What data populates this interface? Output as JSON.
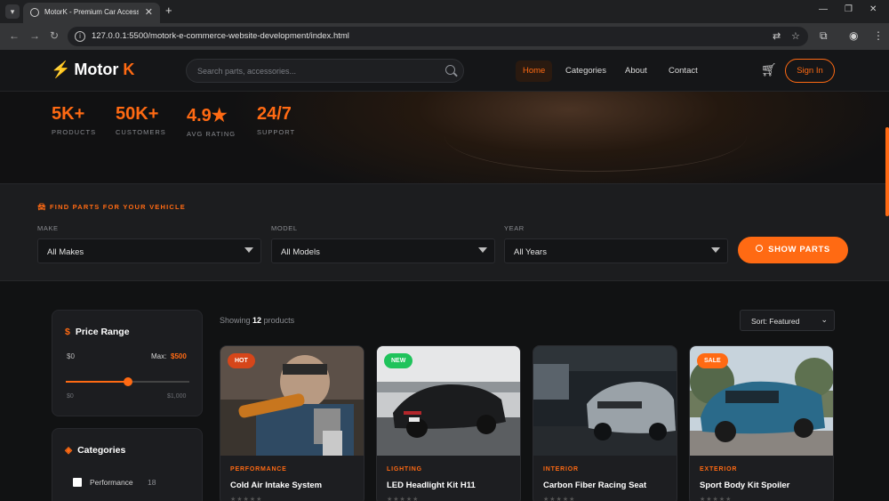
{
  "browser": {
    "tab_title": "MotorK - Premium Car Accessories",
    "url": "127.0.0.1:5500/motork-e-commerce-website-development/index.html"
  },
  "header": {
    "logo_main": "Motor ",
    "logo_accent": "K",
    "search_placeholder": "Search parts, accessories...",
    "nav": [
      "Home",
      "Categories",
      "About",
      "Contact"
    ],
    "signin_label": "Sign In"
  },
  "stats": [
    {
      "value": "5K+",
      "label": "PRODUCTS"
    },
    {
      "value": "50K+",
      "label": "CUSTOMERS"
    },
    {
      "value": "4.9★",
      "label": "AVG RATING"
    },
    {
      "value": "24/7",
      "label": "SUPPORT"
    }
  ],
  "finder": {
    "title": "FIND PARTS FOR YOUR VEHICLE",
    "make_label": "MAKE",
    "make_value": "All Makes",
    "model_label": "MODEL",
    "model_value": "All Models",
    "year_label": "YEAR",
    "year_value": "All Years",
    "button": "SHOW PARTS"
  },
  "sidebar": {
    "price": {
      "title": "Price Range",
      "min_value": "$0",
      "max_prefix": "Max:",
      "max_value": "$500",
      "scale_min": "$0",
      "scale_max": "$1,000",
      "slider_fraction": 0.5
    },
    "categories": {
      "title": "Categories",
      "items": [
        {
          "label": "Performance",
          "count": "18"
        }
      ]
    }
  },
  "listing": {
    "showing_prefix": "Showing",
    "count": "12",
    "showing_suffix": "products",
    "sort_value": "Sort: Featured"
  },
  "products": [
    {
      "badge": "HOT",
      "category": "PERFORMANCE",
      "name": "Cold Air Intake System",
      "stars": "★★★★★"
    },
    {
      "badge": "NEW",
      "category": "LIGHTING",
      "name": "LED Headlight Kit H11",
      "stars": "★★★★★"
    },
    {
      "badge": "",
      "category": "INTERIOR",
      "name": "Carbon Fiber Racing Seat",
      "stars": "★★★★★"
    },
    {
      "badge": "SALE",
      "category": "EXTERIOR",
      "name": "Sport Body Kit Spoiler",
      "stars": "★★★★★"
    }
  ],
  "colors": {
    "accent": "#ff6a13",
    "badge_new": "#1fc35b",
    "badge_hot": "#d6461a",
    "badge_sale": "#ff6a13"
  }
}
